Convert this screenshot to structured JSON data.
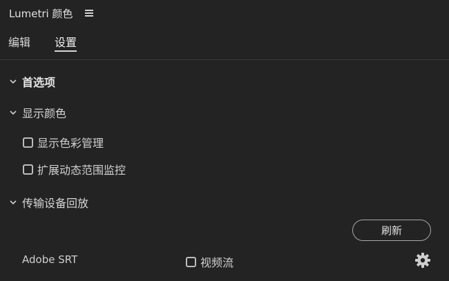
{
  "header": {
    "title": "Lumetri 颜色",
    "menu_icon": "hamburger-menu-icon"
  },
  "tabs": [
    {
      "label": "编辑",
      "active": false
    },
    {
      "label": "设置",
      "active": true
    }
  ],
  "sections": {
    "preferences": {
      "label": "首选项",
      "expanded": true
    },
    "display_color": {
      "label": "显示颜色",
      "expanded": true
    },
    "transmit": {
      "label": "传输设备回放",
      "expanded": true
    }
  },
  "display_options": {
    "color_management": {
      "label": "显示色彩管理",
      "checked": false
    },
    "hdr_monitoring": {
      "label": "扩展动态范围监控",
      "checked": false
    }
  },
  "transmit": {
    "refresh_label": "刷新",
    "device_name": "Adobe SRT",
    "video_stream_label": "视频流",
    "video_stream_checked": false,
    "settings_icon": "gear-icon"
  },
  "colors": {
    "background": "#232323",
    "text": "#d6d6d6",
    "divider": "#3a3a3a"
  }
}
